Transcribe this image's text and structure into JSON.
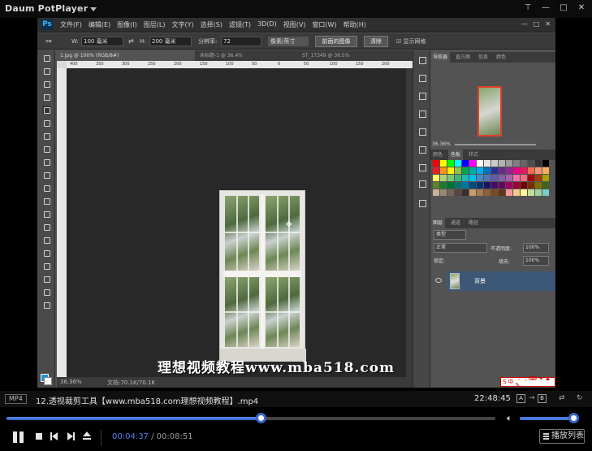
{
  "player": {
    "title": "Daum PotPlayer",
    "format_badge": "MP4",
    "file_name": "12.透视裁剪工具【www.mba518.com理想视频教程】.mp4",
    "clock": "22:48:45",
    "ab_a": "A",
    "ab_b": "B",
    "time_current": "00:04:37",
    "time_separator": " / ",
    "time_total": "00:08:51",
    "progress": 0.52,
    "volume": 0.92,
    "playlist_label": "播放列表"
  },
  "photoshop": {
    "logo": "Ps",
    "menus": [
      "文件(F)",
      "编辑(E)",
      "图像(I)",
      "图层(L)",
      "文字(Y)",
      "选择(S)",
      "滤镜(T)",
      "3D(D)",
      "视图(V)",
      "窗口(W)",
      "帮助(H)"
    ],
    "options": {
      "w_label": "W:",
      "w_value": "100 毫米",
      "h_label": "H:",
      "h_value": "200 毫米",
      "res_label": "分辨率:",
      "res_value": "72",
      "unit_value": "像素/英寸",
      "front_image_btn": "前面的图像",
      "clear_btn": "清除",
      "show_grid_label": "显示网格"
    },
    "doc_tabs": [
      "1.jpg @ 100% (RGB/8#)",
      "未标题-1 @ 36.4%",
      "ST_17349 @ 36.5%"
    ],
    "ruler_ticks": [
      "400",
      "350",
      "300",
      "250",
      "200",
      "150",
      "100",
      "50",
      "0",
      "50",
      "100",
      "150",
      "200"
    ],
    "status_zoom": "36.36%",
    "status_doc": "文档:70.1K/70.1K",
    "nav_tabs": [
      "导航器",
      "直方图",
      "信息",
      "颜色"
    ],
    "nav_zoom": "36.36%",
    "swatch_tabs": [
      "颜色",
      "色板",
      "样式"
    ],
    "layer_tabs": [
      "图层",
      "通道",
      "路径"
    ],
    "kind_label": "类型",
    "blend_mode": "正常",
    "opacity_label": "不透明度:",
    "opacity_value": "100%",
    "lock_label": "锁定:",
    "fill_label": "填充:",
    "fill_value": "100%",
    "layer_name": "背景",
    "ime_label": "中"
  },
  "watermark": "理想视频教程www.mba518.com",
  "colors": {
    "accent": "#3a66cc",
    "time_current": "#4f86f0",
    "layer_selected": "#3d5877",
    "nav_box": "#e0402a",
    "fg_color": "#1e8fd9"
  }
}
